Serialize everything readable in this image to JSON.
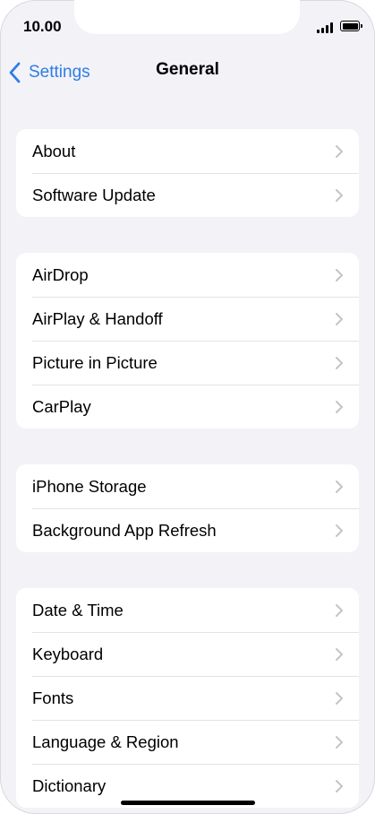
{
  "status_bar": {
    "time": "10.00"
  },
  "nav": {
    "back_label": "Settings",
    "title": "General"
  },
  "groups": [
    {
      "items": [
        {
          "label": "About"
        },
        {
          "label": "Software Update"
        }
      ]
    },
    {
      "items": [
        {
          "label": "AirDrop"
        },
        {
          "label": "AirPlay & Handoff"
        },
        {
          "label": "Picture in Picture"
        },
        {
          "label": "CarPlay"
        }
      ]
    },
    {
      "items": [
        {
          "label": "iPhone Storage"
        },
        {
          "label": "Background App Refresh"
        }
      ]
    },
    {
      "items": [
        {
          "label": "Date & Time"
        },
        {
          "label": "Keyboard"
        },
        {
          "label": "Fonts"
        },
        {
          "label": "Language & Region"
        },
        {
          "label": "Dictionary"
        }
      ]
    }
  ],
  "colors": {
    "accent": "#2f7ce6",
    "background": "#f2f2f7",
    "chevron": "#c4c4c7"
  },
  "icons": {
    "back": "chevron-left-icon",
    "disclosure": "chevron-right-icon"
  }
}
